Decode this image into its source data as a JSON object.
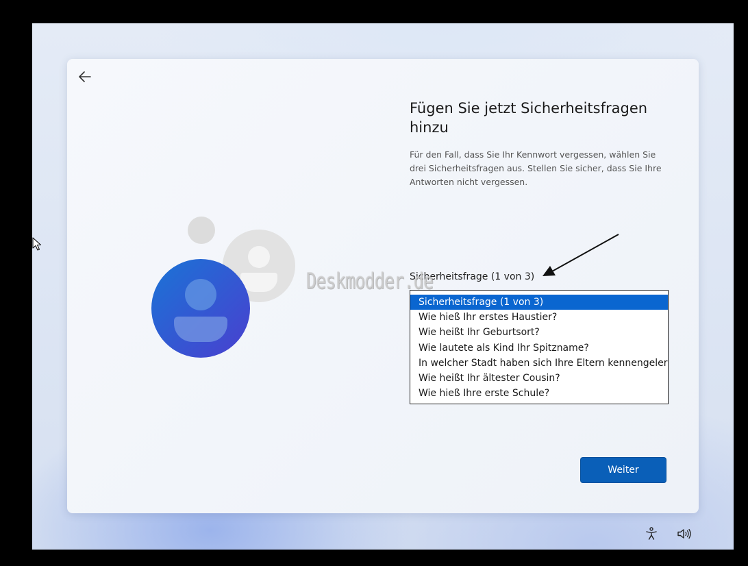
{
  "header": {
    "title": "Fügen Sie jetzt Sicherheitsfragen hinzu",
    "description": "Für den Fall, dass Sie Ihr Kennwort vergessen, wählen Sie drei Sicherheitsfragen aus. Stellen Sie sicher, dass Sie Ihre Antworten nicht vergessen."
  },
  "security_question": {
    "label": "Sicherheitsfrage (1 von 3)",
    "selected": "Sicherheitsfrage (1 von 3)",
    "options": [
      "Sicherheitsfrage (1 von 3)",
      "Wie hieß Ihr erstes Haustier?",
      "Wie heißt Ihr Geburtsort?",
      "Wie lautete als Kind Ihr Spitzname?",
      "In welcher Stadt haben sich Ihre Eltern kennengelernt?",
      "Wie heißt Ihr ältester Cousin?",
      "Wie hieß Ihre erste Schule?"
    ]
  },
  "buttons": {
    "next_label": "Weiter"
  },
  "watermark": "Deskmodder.de",
  "icons": {
    "back": "back-arrow-icon",
    "accessibility": "accessibility-icon",
    "volume": "volume-icon",
    "illustration": "user-accounts-illustration"
  },
  "colors": {
    "accent": "#0a5fb8",
    "selection": "#0a66d0"
  }
}
